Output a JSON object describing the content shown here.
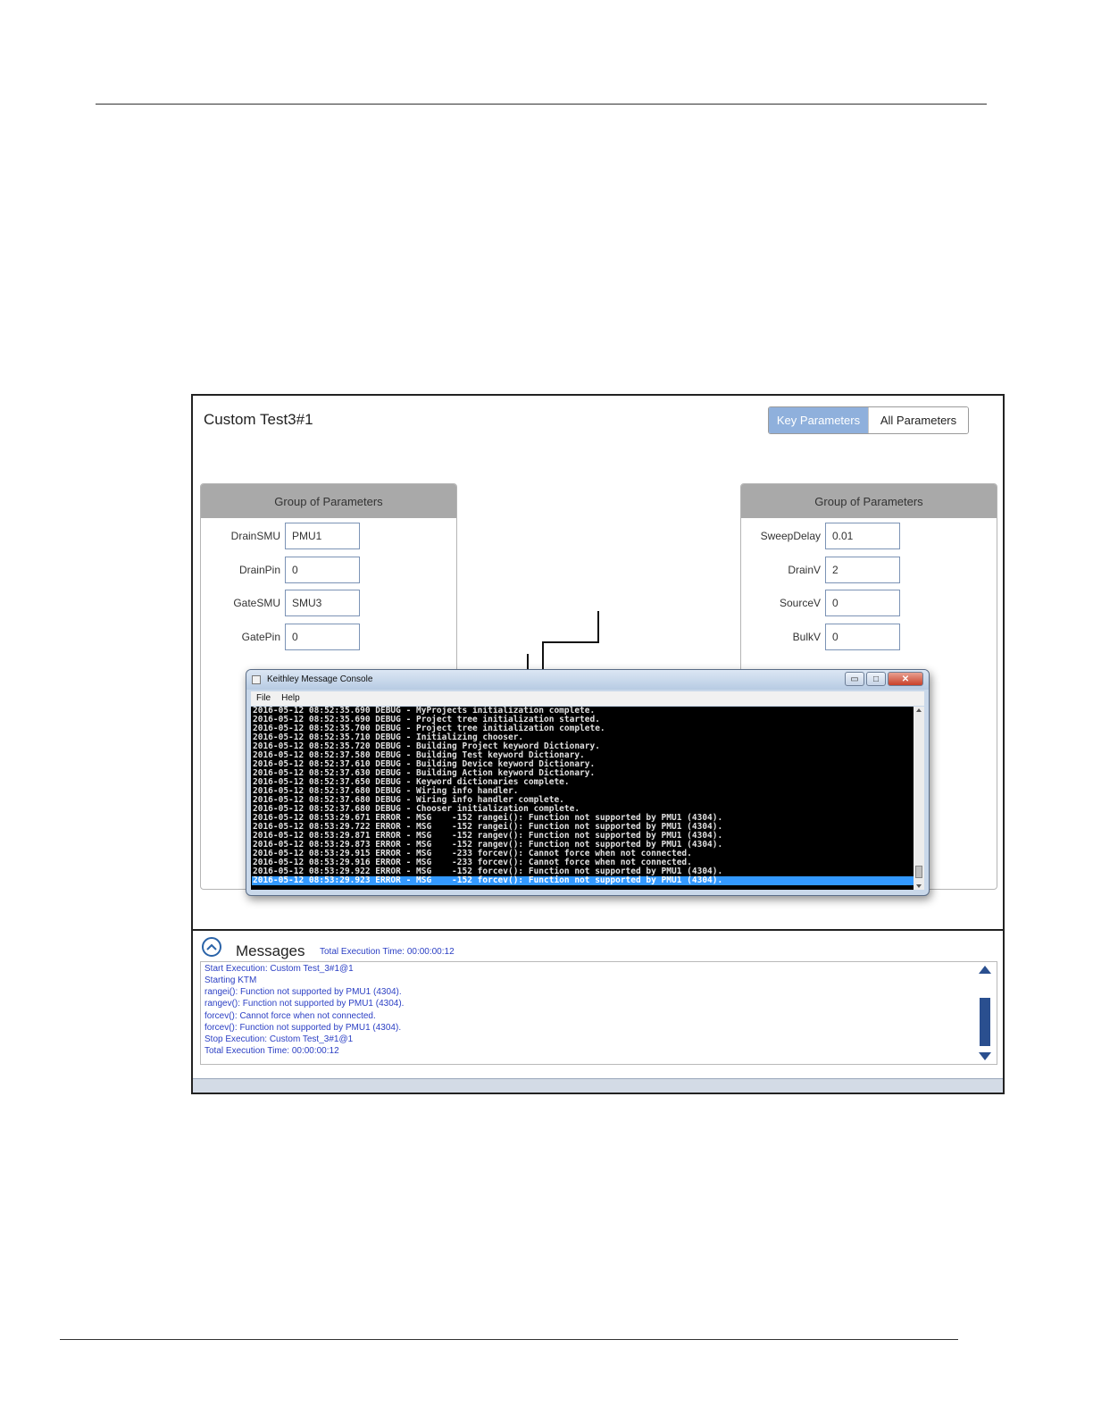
{
  "app": {
    "title": "Custom Test3#1",
    "view_tabs": [
      {
        "label": "Key Parameters",
        "active": true
      },
      {
        "label": "All Parameters",
        "active": false
      }
    ]
  },
  "left_group": {
    "header": "Group of Parameters",
    "params": [
      {
        "label": "DrainSMU",
        "value": "PMU1"
      },
      {
        "label": "DrainPin",
        "value": "0"
      },
      {
        "label": "GateSMU",
        "value": "SMU3"
      },
      {
        "label": "GatePin",
        "value": "0"
      }
    ]
  },
  "right_group": {
    "header": "Group of Parameters",
    "params": [
      {
        "label": "SweepDelay",
        "value": "0.01"
      },
      {
        "label": "DrainV",
        "value": "2"
      },
      {
        "label": "SourceV",
        "value": "0"
      },
      {
        "label": "BulkV",
        "value": "0"
      }
    ]
  },
  "messages": {
    "title": "Messages",
    "total_time": "Total Execution Time: 00:00:00:12",
    "lines": [
      "Start Execution: Custom Test_3#1@1",
      "Starting KTM",
      "rangei(): Function not supported by PMU1 (4304).",
      "rangev(): Function not supported by PMU1 (4304).",
      "forcev(): Cannot force when not connected.",
      "forcev(): Function not supported by PMU1 (4304).",
      "Stop Execution:  Custom Test_3#1@1",
      "Total Execution Time: 00:00:00:12"
    ]
  },
  "console": {
    "title": "Keithley Message Console",
    "menu": [
      "File",
      "Help"
    ],
    "window_buttons": {
      "minimize": "▭",
      "maximize": "□",
      "close": "✕"
    },
    "lines": [
      "2016-05-12 08:52:35.690 DEBUG - MyProjects initialization complete.",
      "2016-05-12 08:52:35.690 DEBUG - Project tree initialization started.",
      "2016-05-12 08:52:35.700 DEBUG - Project tree initialization complete.",
      "2016-05-12 08:52:35.710 DEBUG - Initializing chooser.",
      "2016-05-12 08:52:35.720 DEBUG - Building Project keyword Dictionary.",
      "2016-05-12 08:52:37.580 DEBUG - Building Test keyword Dictionary.",
      "2016-05-12 08:52:37.610 DEBUG - Building Device keyword Dictionary.",
      "2016-05-12 08:52:37.630 DEBUG - Building Action keyword Dictionary.",
      "2016-05-12 08:52:37.650 DEBUG - Keyword dictionaries complete.",
      "2016-05-12 08:52:37.680 DEBUG - Wiring info handler.",
      "2016-05-12 08:52:37.680 DEBUG - Wiring info handler complete.",
      "2016-05-12 08:52:37.680 DEBUG - Chooser initialization complete.",
      "2016-05-12 08:53:29.671 ERROR - MSG    -152 rangei(): Function not supported by PMU1 (4304).",
      "2016-05-12 08:53:29.722 ERROR - MSG    -152 rangei(): Function not supported by PMU1 (4304).",
      "2016-05-12 08:53:29.871 ERROR - MSG    -152 rangev(): Function not supported by PMU1 (4304).",
      "2016-05-12 08:53:29.873 ERROR - MSG    -152 rangev(): Function not supported by PMU1 (4304).",
      "2016-05-12 08:53:29.915 ERROR - MSG    -233 forcev(): Cannot force when not connected.",
      "2016-05-12 08:53:29.916 ERROR - MSG    -233 forcev(): Cannot force when not connected.",
      "2016-05-12 08:53:29.922 ERROR - MSG    -152 forcev(): Function not supported by PMU1 (4304).",
      "2016-05-12 08:53:29.923 ERROR - MSG    -152 forcev(): Function not supported by PMU1 (4304)."
    ],
    "selected_index": 19
  },
  "colors": {
    "accent": "#8fb0dc",
    "message_text": "#2b3fc4",
    "selection": "#3399ff"
  }
}
